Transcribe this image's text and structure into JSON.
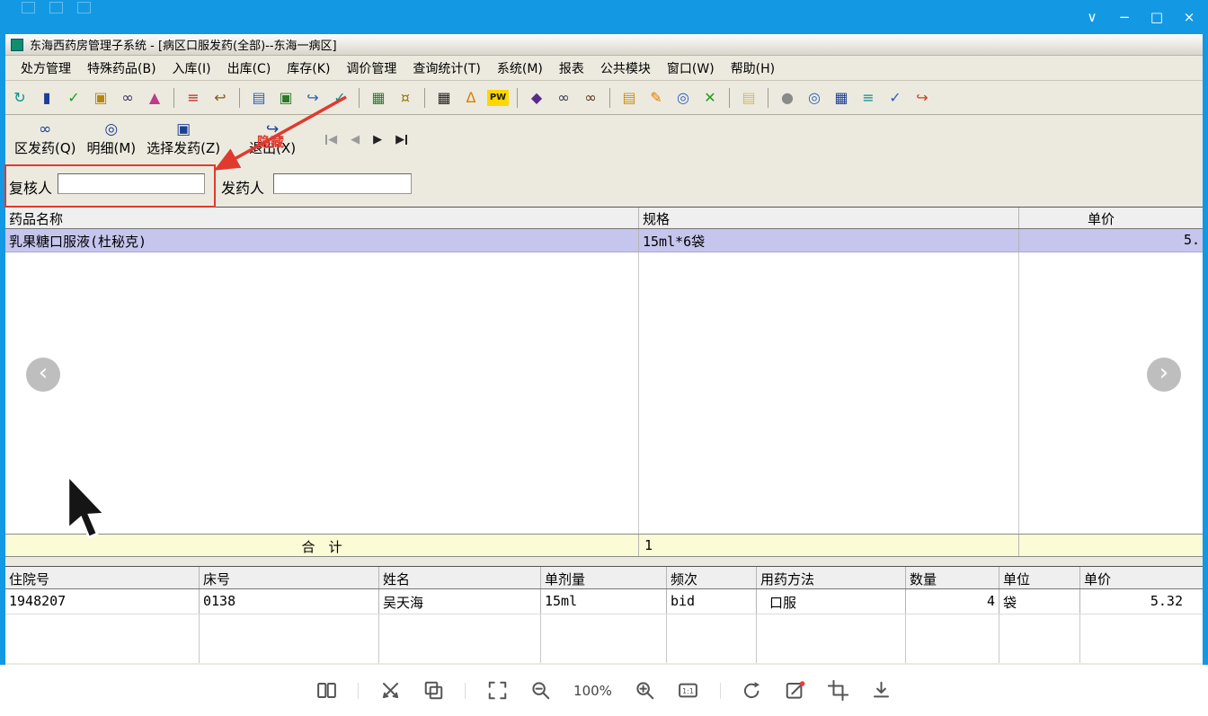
{
  "viewer": {
    "window_controls": [
      {
        "name": "restore-down",
        "glyph": "∨"
      },
      {
        "name": "minimize",
        "glyph": "−"
      },
      {
        "name": "maximize",
        "glyph": "□"
      },
      {
        "name": "close",
        "glyph": "×"
      }
    ],
    "zoom_level": "100%",
    "toolbar": [
      "panels",
      "|",
      "flip",
      "slideshow",
      "|",
      "fit-screen",
      "zoom-out",
      "zoom-level",
      "zoom-in",
      "actual-size",
      "|",
      "rotate",
      "edit",
      "crop",
      "download"
    ]
  },
  "app": {
    "title": "东海西药房管理子系统 - [病区口服发药(全部)--东海一病区]",
    "menu": [
      "处方管理",
      "特殊药品(B)",
      "入库(I)",
      "出库(C)",
      "库存(K)",
      "调价管理",
      "查询统计(T)",
      "系统(M)",
      "报表",
      "公共模块",
      "窗口(W)",
      "帮助(H)"
    ],
    "toolbar_icons": [
      {
        "name": "refresh",
        "glyph": "↻",
        "color": "#0b8f8f"
      },
      {
        "name": "medicine-bottle",
        "glyph": "▮",
        "color": "#1c3f94"
      },
      {
        "name": "approve-check",
        "glyph": "✓",
        "color": "#1e9e1e"
      },
      {
        "name": "stamp",
        "glyph": "▣",
        "color": "#b8860b"
      },
      {
        "name": "binoculars",
        "glyph": "∞",
        "color": "#333355"
      },
      {
        "name": "flask",
        "glyph": "▲",
        "color": "#c03a8c"
      },
      "|",
      {
        "name": "report-red",
        "glyph": "≡",
        "color": "#c02020"
      },
      {
        "name": "return-doc",
        "glyph": "↩",
        "color": "#8a5a1a"
      },
      "|",
      {
        "name": "new-doc",
        "glyph": "▤",
        "color": "#2b5fc0"
      },
      {
        "name": "check-doc",
        "glyph": "▣",
        "color": "#2a7a2a"
      },
      {
        "name": "forward-doc",
        "glyph": "↪",
        "color": "#2b5fc0"
      },
      {
        "name": "verify-doc",
        "glyph": "✓",
        "color": "#0b8f8f"
      },
      "|",
      {
        "name": "chart",
        "glyph": "▦",
        "color": "#2a7a2a"
      },
      {
        "name": "money-table",
        "glyph": "¤",
        "color": "#9a7a10"
      },
      "|",
      {
        "name": "grid",
        "glyph": "▦",
        "color": "#222222"
      },
      {
        "name": "bell",
        "glyph": "Δ",
        "color": "#e07b00"
      },
      {
        "name": "password",
        "glyph": "PW",
        "color": "#222200",
        "bg": "#ffd700"
      },
      "|",
      {
        "name": "bag",
        "glyph": "◆",
        "color": "#5a2a8a"
      },
      {
        "name": "binoculars-2",
        "glyph": "∞",
        "color": "#333355"
      },
      {
        "name": "find-drug",
        "glyph": "∞",
        "color": "#55331a"
      },
      "|",
      {
        "name": "folder",
        "glyph": "▤",
        "color": "#d09010"
      },
      {
        "name": "pen",
        "glyph": "✎",
        "color": "#e07b00"
      },
      {
        "name": "magnifier",
        "glyph": "◎",
        "color": "#2b5fc0"
      },
      {
        "name": "close-box",
        "glyph": "✕",
        "color": "#1e9e1e"
      },
      "|",
      {
        "name": "folder-open",
        "glyph": "▤",
        "color": "#d8b860"
      },
      "|",
      {
        "name": "sphere",
        "glyph": "●",
        "color": "#8a8a8a"
      },
      {
        "name": "magnifier-2",
        "glyph": "◎",
        "color": "#2b5fc0"
      },
      {
        "name": "calendar",
        "glyph": "▦",
        "color": "#1c3f94"
      },
      {
        "name": "layers",
        "glyph": "≡",
        "color": "#0b8f8f"
      },
      {
        "name": "doc-check",
        "glyph": "✓",
        "color": "#2b5fc0"
      },
      {
        "name": "exit-door",
        "glyph": "↪",
        "color": "#d04010"
      }
    ],
    "action_buttons": [
      {
        "name": "ward-dispense",
        "label": "区发药(Q)",
        "glyph": "∞"
      },
      {
        "name": "detail",
        "label": "明细(M)",
        "glyph": "◎"
      },
      {
        "name": "select-dispense",
        "label": "选择发药(Z)",
        "glyph": "▣"
      },
      {
        "name": "exit",
        "label": "退出(X)",
        "glyph": "↪"
      }
    ],
    "vcr": [
      {
        "name": "first",
        "glyph": "◀",
        "bar": "left",
        "dim": true
      },
      {
        "name": "prev",
        "glyph": "◀",
        "dim": true
      },
      {
        "name": "next",
        "glyph": "▶"
      },
      {
        "name": "last",
        "glyph": "▶",
        "bar": "right"
      }
    ],
    "form": {
      "reviewer_label": "复核人",
      "reviewer_value": "",
      "dispenser_label": "发药人",
      "dispenser_value": ""
    },
    "drug_table": {
      "columns": [
        "药品名称",
        "规格",
        "单价"
      ],
      "rows": [
        [
          "乳果糖口服液(杜秘克)",
          "15ml*6袋",
          "5."
        ]
      ],
      "total_label": "合　计",
      "total_qty": "1"
    },
    "patient_table": {
      "columns": [
        "住院号",
        "床号",
        "姓名",
        "单剂量",
        "频次",
        "用药方法",
        "数量",
        "单位",
        "单价"
      ],
      "rows": [
        [
          "1948207",
          "0138",
          "吴天海",
          "15ml",
          "bid",
          "口服",
          "4",
          "袋",
          "5.32"
        ]
      ]
    },
    "annotation": {
      "hide_label": "隐藏"
    }
  }
}
